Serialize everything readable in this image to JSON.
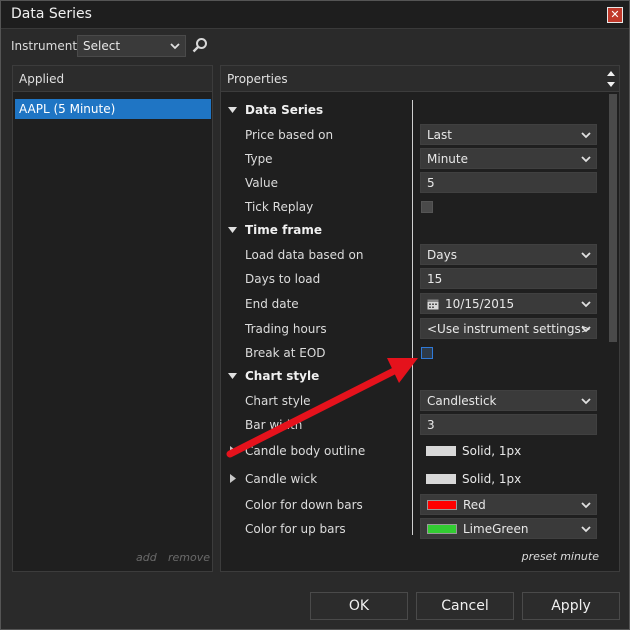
{
  "window": {
    "title": "Data Series",
    "close_glyph": "✕"
  },
  "instrument": {
    "label": "Instrument",
    "selected": "Select"
  },
  "applied": {
    "header": "Applied",
    "items": [
      "AAPL (5 Minute)"
    ],
    "add_label": "add",
    "remove_label": "remove"
  },
  "properties": {
    "header": "Properties",
    "preset_label": "preset minute",
    "rows": [
      {
        "kind": "category",
        "label": "Data Series"
      },
      {
        "kind": "select",
        "label": "Price based on",
        "value": "Last"
      },
      {
        "kind": "select",
        "label": "Type",
        "value": "Minute"
      },
      {
        "kind": "text",
        "label": "Value",
        "value": "5"
      },
      {
        "kind": "checkbox",
        "label": "Tick Replay",
        "checked": false
      },
      {
        "kind": "category",
        "label": "Time frame"
      },
      {
        "kind": "select",
        "label": "Load data based on",
        "value": "Days"
      },
      {
        "kind": "text",
        "label": "Days to load",
        "value": "15"
      },
      {
        "kind": "date",
        "label": "End date",
        "value": "10/15/2015"
      },
      {
        "kind": "select",
        "label": "Trading hours",
        "value": "<Use instrument settings>"
      },
      {
        "kind": "checkbox",
        "label": "Break at EOD",
        "checked": false,
        "focus": true
      },
      {
        "kind": "category",
        "label": "Chart style"
      },
      {
        "kind": "select",
        "label": "Chart style",
        "value": "Candlestick"
      },
      {
        "kind": "text",
        "label": "Bar width",
        "value": "3"
      },
      {
        "kind": "stroke",
        "label": "Candle body outline",
        "value": "Solid, 1px"
      },
      {
        "kind": "stroke",
        "label": "Candle wick",
        "value": "Solid, 1px"
      },
      {
        "kind": "color",
        "label": "Color for down bars",
        "value": "Red",
        "color": "#ff0000"
      },
      {
        "kind": "color",
        "label": "Color for up bars",
        "value": "LimeGreen",
        "color": "#32cd32"
      }
    ]
  },
  "buttons": {
    "ok": "OK",
    "cancel": "Cancel",
    "apply": "Apply"
  },
  "colors": {
    "selection": "#1f75c4",
    "annotation_arrow": "#e5121c"
  }
}
